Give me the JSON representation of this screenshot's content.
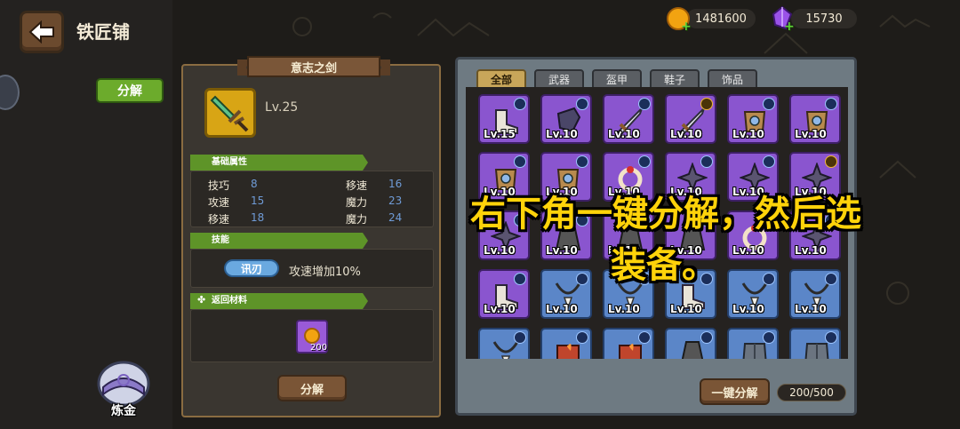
{
  "header": {
    "title": "铁匠铺"
  },
  "resources": {
    "gold": "1481600",
    "gems": "15730"
  },
  "side": {
    "decompose_tab": "分解",
    "alchemy_label": "炼金"
  },
  "detail": {
    "item_name": "意志之剑",
    "level": "Lv.25",
    "base_stats_title": "基础属性",
    "stats_left": [
      {
        "name": "技巧",
        "value": "8"
      },
      {
        "name": "攻速",
        "value": "15"
      },
      {
        "name": "移速",
        "value": "18"
      }
    ],
    "stats_right": [
      {
        "name": "移速",
        "value": "16"
      },
      {
        "name": "魔力",
        "value": "23"
      },
      {
        "name": "魔力",
        "value": "24"
      }
    ],
    "skill_title": "技能",
    "skill_name": "讯刃",
    "skill_desc": "攻速增加10%",
    "materials_title": "返回材料",
    "material_count": "200",
    "decompose_button": "分解"
  },
  "inventory": {
    "tabs": [
      "全部",
      "武器",
      "盔甲",
      "鞋子",
      "饰品"
    ],
    "active_tab": 0,
    "slots": [
      {
        "rarity": "purple",
        "lv": "Lv.15",
        "icon": "boots-icon",
        "badge": "blue"
      },
      {
        "rarity": "purple",
        "lv": "Lv.10",
        "icon": "gauntlet-icon",
        "badge": "blue"
      },
      {
        "rarity": "purple",
        "lv": "Lv.10",
        "icon": "sword-icon",
        "badge": "blue"
      },
      {
        "rarity": "purple",
        "lv": "Lv.10",
        "icon": "sword-icon",
        "badge": "gold"
      },
      {
        "rarity": "purple",
        "lv": "Lv.10",
        "icon": "armor-icon",
        "badge": "blue"
      },
      {
        "rarity": "purple",
        "lv": "Lv.10",
        "icon": "armor-icon",
        "badge": "blue"
      },
      {
        "rarity": "purple",
        "lv": "Lv.10",
        "icon": "armor-icon",
        "badge": "blue"
      },
      {
        "rarity": "purple",
        "lv": "Lv.10",
        "icon": "armor-icon",
        "badge": "blue"
      },
      {
        "rarity": "purple",
        "lv": "Lv.10",
        "icon": "ring-icon",
        "badge": "blue"
      },
      {
        "rarity": "purple",
        "lv": "Lv.10",
        "icon": "shuriken-icon",
        "badge": "blue"
      },
      {
        "rarity": "purple",
        "lv": "Lv.10",
        "icon": "shuriken-icon",
        "badge": "blue"
      },
      {
        "rarity": "purple",
        "lv": "Lv.10",
        "icon": "shuriken-icon",
        "badge": "gold"
      },
      {
        "rarity": "purple",
        "lv": "Lv.10",
        "icon": "shuriken-icon",
        "badge": "blue"
      },
      {
        "rarity": "purple",
        "lv": "Lv.10",
        "icon": "cloak-icon",
        "badge": "blue"
      },
      {
        "rarity": "purple",
        "lv": "Lv.10",
        "icon": "cloak-icon",
        "badge": "blue"
      },
      {
        "rarity": "purple",
        "lv": "Lv.10",
        "icon": "cloak-icon",
        "badge": "blue"
      },
      {
        "rarity": "purple",
        "lv": "Lv.10",
        "icon": "ring-icon",
        "badge": "blue"
      },
      {
        "rarity": "purple",
        "lv": "Lv.10",
        "icon": "shuriken-icon",
        "badge": "blue"
      },
      {
        "rarity": "purple",
        "lv": "Lv.10",
        "icon": "boots-icon",
        "badge": "blue"
      },
      {
        "rarity": "blue",
        "lv": "Lv.10",
        "icon": "necklace-icon",
        "badge": "blue"
      },
      {
        "rarity": "blue",
        "lv": "Lv.10",
        "icon": "necklace-icon",
        "badge": "blue"
      },
      {
        "rarity": "blue",
        "lv": "Lv.10",
        "icon": "boots-icon",
        "badge": "blue"
      },
      {
        "rarity": "blue",
        "lv": "Lv.10",
        "icon": "necklace-icon",
        "badge": "blue"
      },
      {
        "rarity": "blue",
        "lv": "Lv.10",
        "icon": "necklace-icon",
        "badge": "blue"
      },
      {
        "rarity": "blue",
        "lv": "",
        "icon": "necklace-icon",
        "badge": "blue"
      },
      {
        "rarity": "blue",
        "lv": "",
        "icon": "spellbook-icon",
        "badge": "blue"
      },
      {
        "rarity": "blue",
        "lv": "",
        "icon": "spellbook-icon",
        "badge": "blue"
      },
      {
        "rarity": "blue",
        "lv": "",
        "icon": "cloak-icon",
        "badge": "blue"
      },
      {
        "rarity": "blue",
        "lv": "",
        "icon": "chest-armor-icon",
        "badge": "blue"
      },
      {
        "rarity": "blue",
        "lv": "",
        "icon": "chest-armor-icon",
        "badge": "blue"
      }
    ],
    "one_key_decompose": "一键分解",
    "capacity": "200/500"
  },
  "overlay": {
    "line1": "右下角一键分解，然后选",
    "line2": "装备。"
  },
  "colors": {
    "purple": "#8a55cf",
    "blue": "#5b86c8",
    "green": "#6cab2c",
    "gold": "#d8a515",
    "overlay_text": "#ffd30a"
  }
}
